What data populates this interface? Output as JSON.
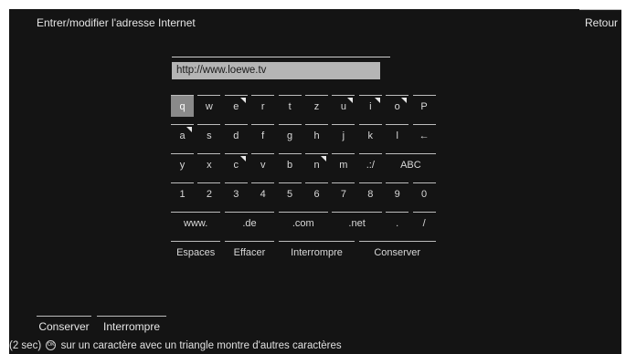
{
  "header": {
    "title": "Entrer/modifier l'adresse Internet",
    "back_label": "Retour"
  },
  "url_field": {
    "value": "http://www.loewe.tv"
  },
  "keyboard": {
    "rows": [
      [
        {
          "label": "q",
          "selected": true
        },
        {
          "label": "w"
        },
        {
          "label": "e",
          "tri": true
        },
        {
          "label": "r"
        },
        {
          "label": "t"
        },
        {
          "label": "z"
        },
        {
          "label": "u",
          "tri": true
        },
        {
          "label": "i",
          "tri": true
        },
        {
          "label": "o",
          "tri": true
        },
        {
          "label": "P"
        }
      ],
      [
        {
          "label": "a",
          "tri": true
        },
        {
          "label": "s"
        },
        {
          "label": "d"
        },
        {
          "label": "f"
        },
        {
          "label": "g"
        },
        {
          "label": "h"
        },
        {
          "label": "j"
        },
        {
          "label": "k"
        },
        {
          "label": "l"
        },
        {
          "label": "←"
        }
      ],
      [
        {
          "label": "y"
        },
        {
          "label": "x"
        },
        {
          "label": "c",
          "tri": true
        },
        {
          "label": "v"
        },
        {
          "label": "b"
        },
        {
          "label": "n",
          "tri": true
        },
        {
          "label": "m"
        },
        {
          "label": ".:/"
        },
        {
          "label": "ABC",
          "span": 2
        }
      ],
      [
        {
          "label": "1"
        },
        {
          "label": "2"
        },
        {
          "label": "3"
        },
        {
          "label": "4"
        },
        {
          "label": "5"
        },
        {
          "label": "6"
        },
        {
          "label": "7"
        },
        {
          "label": "8"
        },
        {
          "label": "9"
        },
        {
          "label": "0"
        }
      ],
      [
        {
          "label": "www.",
          "span": 2
        },
        {
          "label": ".de",
          "span": 2
        },
        {
          "label": ".com",
          "span": 2
        },
        {
          "label": ".net",
          "span": 2
        },
        {
          "label": "."
        },
        {
          "label": "/"
        }
      ],
      [
        {
          "label": "Espaces",
          "span": 2
        },
        {
          "label": "Effacer",
          "span": 2
        },
        {
          "label": "Interrompre",
          "span": 3
        },
        {
          "label": "Conserver",
          "span": 3
        }
      ]
    ]
  },
  "footer": {
    "buttons": {
      "save": "Conserver",
      "cancel": "Interrompre"
    },
    "help": {
      "prefix": "(2 sec)",
      "ok_icon": "OK",
      "text": "sur un caractère avec un triangle montre d'autres caractères"
    }
  }
}
